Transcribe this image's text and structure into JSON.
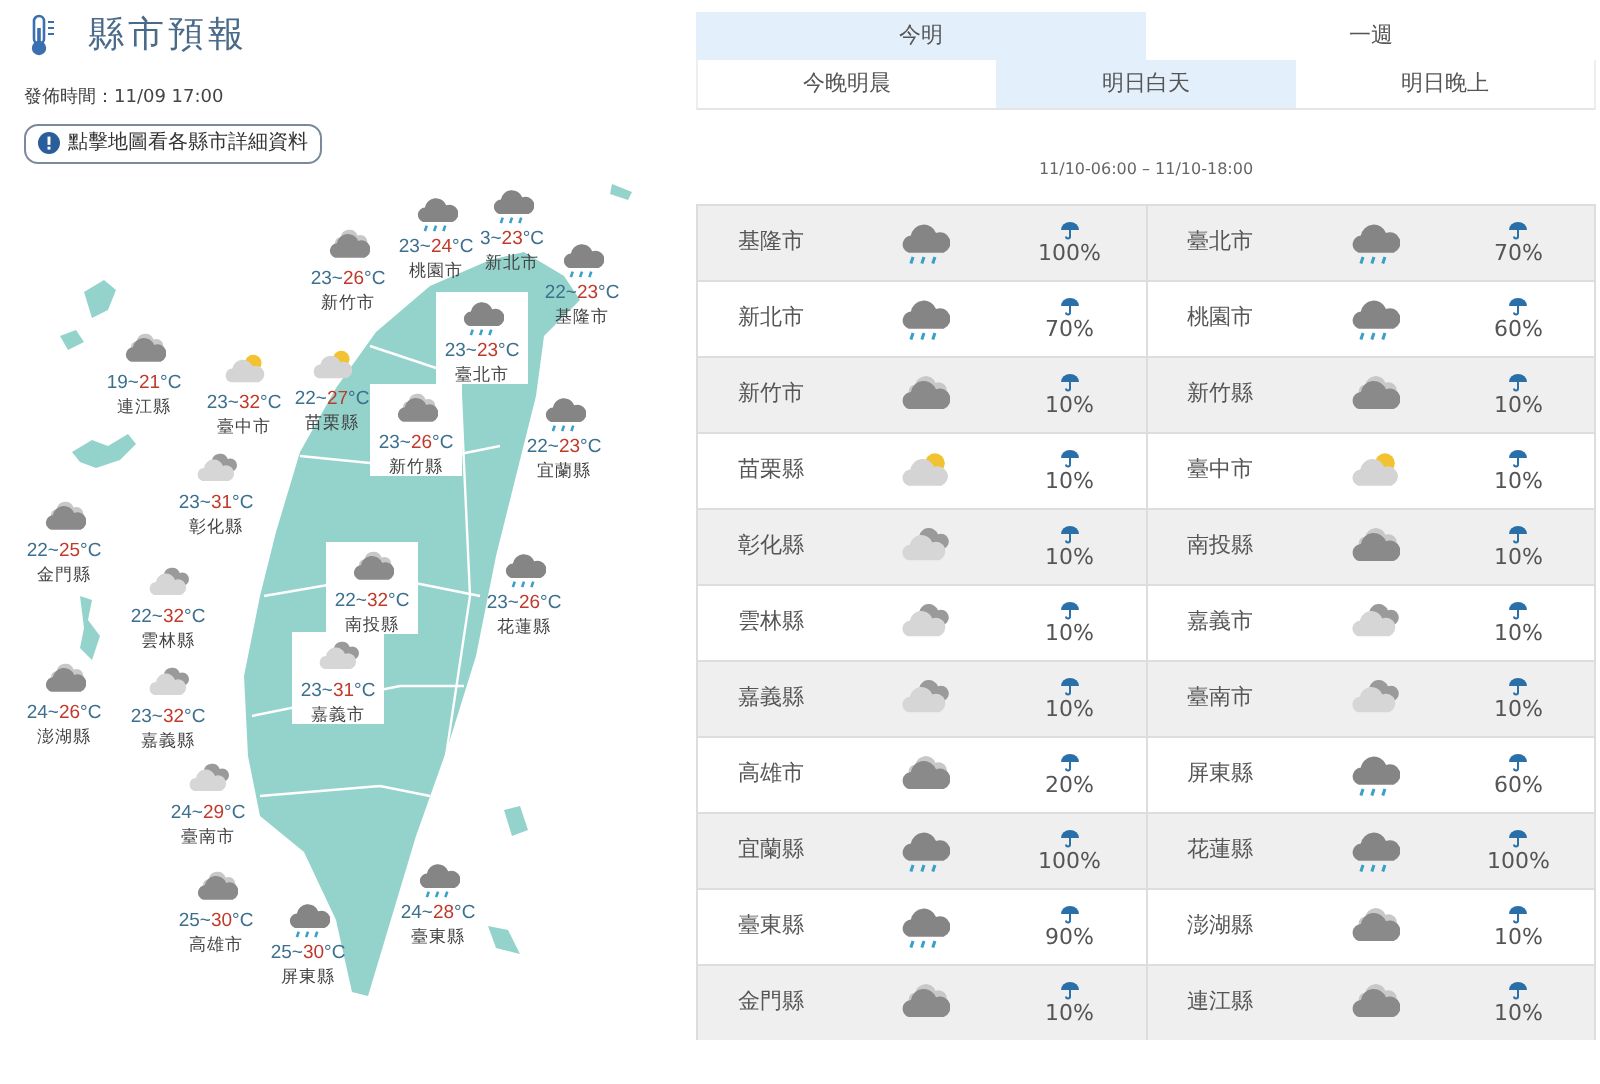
{
  "header": {
    "title": "縣市預報",
    "published": "發佈時間：11/09 17:00",
    "hint_button": "點擊地圖看各縣市詳細資料"
  },
  "map_labels": [
    {
      "name": "新竹市",
      "low": "23~",
      "high": "26",
      "unit": "°C",
      "kind": "cloudy",
      "boxed": false
    },
    {
      "name": "桃園市",
      "low": "23~",
      "high": "24",
      "unit": "°C",
      "kind": "rain",
      "boxed": false
    },
    {
      "name": "新北市",
      "low": "3~",
      "high": "23",
      "unit": "°C",
      "kind": "rain",
      "boxed": false
    },
    {
      "name": "基隆市",
      "low": "22~",
      "high": "23",
      "unit": "°C",
      "kind": "rain",
      "boxed": false
    },
    {
      "name": "臺北市",
      "low": "23~",
      "high": "23",
      "unit": "°C",
      "kind": "rain",
      "boxed": true
    },
    {
      "name": "連江縣",
      "low": "19~",
      "high": "21",
      "unit": "°C",
      "kind": "cloudy",
      "boxed": false
    },
    {
      "name": "臺中市",
      "low": "23~",
      "high": "32",
      "unit": "°C",
      "kind": "partly_sunny",
      "boxed": false
    },
    {
      "name": "苗栗縣",
      "low": "22~",
      "high": "27",
      "unit": "°C",
      "kind": "partly_sunny",
      "boxed": false
    },
    {
      "name": "新竹縣",
      "low": "23~",
      "high": "26",
      "unit": "°C",
      "kind": "cloudy",
      "boxed": true
    },
    {
      "name": "宜蘭縣",
      "low": "22~",
      "high": "23",
      "unit": "°C",
      "kind": "rain",
      "boxed": false
    },
    {
      "name": "彰化縣",
      "low": "23~",
      "high": "31",
      "unit": "°C",
      "kind": "light_cloudy",
      "boxed": false
    },
    {
      "name": "金門縣",
      "low": "22~",
      "high": "25",
      "unit": "°C",
      "kind": "cloudy",
      "boxed": false
    },
    {
      "name": "南投縣",
      "low": "22~",
      "high": "32",
      "unit": "°C",
      "kind": "cloudy",
      "boxed": true
    },
    {
      "name": "花蓮縣",
      "low": "23~",
      "high": "26",
      "unit": "°C",
      "kind": "rain",
      "boxed": false
    },
    {
      "name": "雲林縣",
      "low": "22~",
      "high": "32",
      "unit": "°C",
      "kind": "light_cloudy",
      "boxed": false
    },
    {
      "name": "澎湖縣",
      "low": "24~",
      "high": "26",
      "unit": "°C",
      "kind": "cloudy",
      "boxed": false
    },
    {
      "name": "嘉義縣",
      "low": "23~",
      "high": "32",
      "unit": "°C",
      "kind": "light_cloudy",
      "boxed": false
    },
    {
      "name": "嘉義市",
      "low": "23~",
      "high": "31",
      "unit": "°C",
      "kind": "light_cloudy",
      "boxed": true
    },
    {
      "name": "臺南市",
      "low": "24~",
      "high": "29",
      "unit": "°C",
      "kind": "light_cloudy",
      "boxed": false
    },
    {
      "name": "高雄市",
      "low": "25~",
      "high": "30",
      "unit": "°C",
      "kind": "cloudy",
      "boxed": false
    },
    {
      "name": "屏東縣",
      "low": "25~",
      "high": "30",
      "unit": "°C",
      "kind": "rain",
      "boxed": false
    },
    {
      "name": "臺東縣",
      "low": "24~",
      "high": "28",
      "unit": "°C",
      "kind": "rain",
      "boxed": false
    }
  ],
  "tabs": [
    {
      "label": "今明",
      "selected": true
    },
    {
      "label": "一週",
      "selected": false
    }
  ],
  "subtabs": [
    {
      "label": "今晚明晨",
      "selected": false
    },
    {
      "label": "明日白天",
      "selected": true
    },
    {
      "label": "明日晚上",
      "selected": false
    }
  ],
  "period": "11/10-06:00 – 11/10-18:00",
  "table_rows": [
    [
      {
        "name": "基隆市",
        "kind": "rain",
        "pop": "100%"
      },
      {
        "name": "臺北市",
        "kind": "rain",
        "pop": "70%"
      }
    ],
    [
      {
        "name": "新北市",
        "kind": "rain",
        "pop": "70%"
      },
      {
        "name": "桃園市",
        "kind": "rain",
        "pop": "60%"
      }
    ],
    [
      {
        "name": "新竹市",
        "kind": "cloudy",
        "pop": "10%"
      },
      {
        "name": "新竹縣",
        "kind": "cloudy",
        "pop": "10%"
      }
    ],
    [
      {
        "name": "苗栗縣",
        "kind": "partly_sunny",
        "pop": "10%"
      },
      {
        "name": "臺中市",
        "kind": "partly_sunny",
        "pop": "10%"
      }
    ],
    [
      {
        "name": "彰化縣",
        "kind": "light_cloudy",
        "pop": "10%"
      },
      {
        "name": "南投縣",
        "kind": "cloudy",
        "pop": "10%"
      }
    ],
    [
      {
        "name": "雲林縣",
        "kind": "light_cloudy",
        "pop": "10%"
      },
      {
        "name": "嘉義市",
        "kind": "light_cloudy",
        "pop": "10%"
      }
    ],
    [
      {
        "name": "嘉義縣",
        "kind": "light_cloudy",
        "pop": "10%"
      },
      {
        "name": "臺南市",
        "kind": "light_cloudy",
        "pop": "10%"
      }
    ],
    [
      {
        "name": "高雄市",
        "kind": "cloudy",
        "pop": "20%"
      },
      {
        "name": "屏東縣",
        "kind": "rain",
        "pop": "60%"
      }
    ],
    [
      {
        "name": "宜蘭縣",
        "kind": "rain",
        "pop": "100%"
      },
      {
        "name": "花蓮縣",
        "kind": "rain",
        "pop": "100%"
      }
    ],
    [
      {
        "name": "臺東縣",
        "kind": "rain",
        "pop": "90%"
      },
      {
        "name": "澎湖縣",
        "kind": "cloudy",
        "pop": "10%"
      }
    ],
    [
      {
        "name": "金門縣",
        "kind": "cloudy",
        "pop": "10%"
      },
      {
        "name": "連江縣",
        "kind": "cloudy",
        "pop": "10%"
      }
    ]
  ]
}
